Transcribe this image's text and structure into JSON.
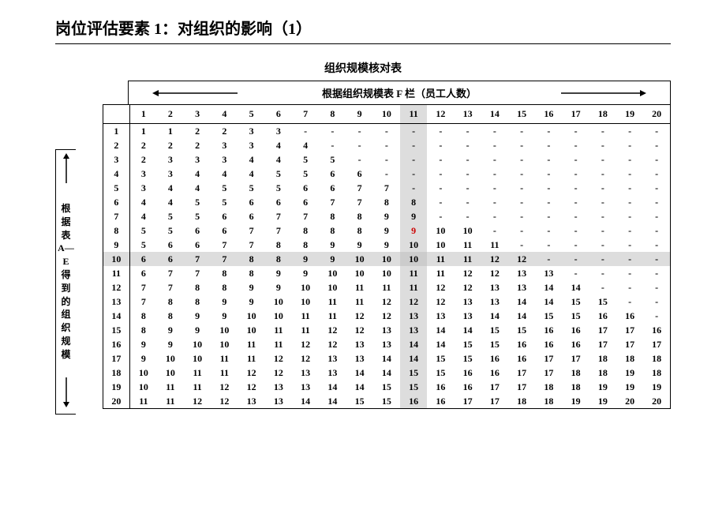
{
  "title": "岗位评估要素 1：对组织的影响（1）",
  "subtitle": "组织规模核对表",
  "topLabel": "根据组织规模表 F 栏（员工人数）",
  "sideLabel": [
    "根",
    "据",
    "表",
    "A—E",
    "得",
    "到",
    "的",
    "组",
    "织",
    "规",
    "模"
  ],
  "highlightCol": 11,
  "highlightRow": 10,
  "redCell": {
    "row": 8,
    "col": 11
  },
  "cols": [
    "1",
    "2",
    "3",
    "4",
    "5",
    "6",
    "7",
    "8",
    "9",
    "10",
    "11",
    "12",
    "13",
    "14",
    "15",
    "16",
    "17",
    "18",
    "19",
    "20"
  ],
  "rows": [
    {
      "h": "1",
      "v": [
        "1",
        "1",
        "2",
        "2",
        "3",
        "3",
        "-",
        "-",
        "-",
        "-",
        "-",
        "-",
        "-",
        "-",
        "-",
        "-",
        "-",
        "-",
        "-",
        "-"
      ]
    },
    {
      "h": "2",
      "v": [
        "2",
        "2",
        "2",
        "3",
        "3",
        "4",
        "4",
        "-",
        "-",
        "-",
        "-",
        "-",
        "-",
        "-",
        "-",
        "-",
        "-",
        "-",
        "-",
        "-"
      ]
    },
    {
      "h": "3",
      "v": [
        "2",
        "3",
        "3",
        "3",
        "4",
        "4",
        "5",
        "5",
        "-",
        "-",
        "-",
        "-",
        "-",
        "-",
        "-",
        "-",
        "-",
        "-",
        "-",
        "-"
      ]
    },
    {
      "h": "4",
      "v": [
        "3",
        "3",
        "4",
        "4",
        "4",
        "5",
        "5",
        "6",
        "6",
        "-",
        "-",
        "-",
        "-",
        "-",
        "-",
        "-",
        "-",
        "-",
        "-",
        "-"
      ]
    },
    {
      "h": "5",
      "v": [
        "3",
        "4",
        "4",
        "5",
        "5",
        "5",
        "6",
        "6",
        "7",
        "7",
        "-",
        "-",
        "-",
        "-",
        "-",
        "-",
        "-",
        "-",
        "-",
        "-"
      ]
    },
    {
      "h": "6",
      "v": [
        "4",
        "4",
        "5",
        "5",
        "6",
        "6",
        "6",
        "7",
        "7",
        "8",
        "8",
        "-",
        "-",
        "-",
        "-",
        "-",
        "-",
        "-",
        "-",
        "-"
      ]
    },
    {
      "h": "7",
      "v": [
        "4",
        "5",
        "5",
        "6",
        "6",
        "7",
        "7",
        "8",
        "8",
        "9",
        "9",
        "-",
        "-",
        "-",
        "-",
        "-",
        "-",
        "-",
        "-",
        "-"
      ]
    },
    {
      "h": "8",
      "v": [
        "5",
        "5",
        "6",
        "6",
        "7",
        "7",
        "8",
        "8",
        "8",
        "9",
        "9",
        "10",
        "10",
        "-",
        "-",
        "-",
        "-",
        "-",
        "-",
        "-"
      ]
    },
    {
      "h": "9",
      "v": [
        "5",
        "6",
        "6",
        "7",
        "7",
        "8",
        "8",
        "9",
        "9",
        "9",
        "10",
        "10",
        "11",
        "11",
        "-",
        "-",
        "-",
        "-",
        "-",
        "-"
      ]
    },
    {
      "h": "10",
      "v": [
        "6",
        "6",
        "7",
        "7",
        "8",
        "8",
        "9",
        "9",
        "10",
        "10",
        "10",
        "11",
        "11",
        "12",
        "12",
        "-",
        "-",
        "-",
        "-",
        "-"
      ]
    },
    {
      "h": "11",
      "v": [
        "6",
        "7",
        "7",
        "8",
        "8",
        "9",
        "9",
        "10",
        "10",
        "10",
        "11",
        "11",
        "12",
        "12",
        "13",
        "13",
        "-",
        "-",
        "-",
        "-"
      ]
    },
    {
      "h": "12",
      "v": [
        "7",
        "7",
        "8",
        "8",
        "9",
        "9",
        "10",
        "10",
        "11",
        "11",
        "11",
        "12",
        "12",
        "13",
        "13",
        "14",
        "14",
        "-",
        "-",
        "-"
      ]
    },
    {
      "h": "13",
      "v": [
        "7",
        "8",
        "8",
        "9",
        "9",
        "10",
        "10",
        "11",
        "11",
        "12",
        "12",
        "12",
        "13",
        "13",
        "14",
        "14",
        "15",
        "15",
        "-",
        "-"
      ]
    },
    {
      "h": "14",
      "v": [
        "8",
        "8",
        "9",
        "9",
        "10",
        "10",
        "11",
        "11",
        "12",
        "12",
        "13",
        "13",
        "13",
        "14",
        "14",
        "15",
        "15",
        "16",
        "16",
        "-"
      ]
    },
    {
      "h": "15",
      "v": [
        "8",
        "9",
        "9",
        "10",
        "10",
        "11",
        "11",
        "12",
        "12",
        "13",
        "13",
        "14",
        "14",
        "15",
        "15",
        "16",
        "16",
        "17",
        "17",
        "16"
      ]
    },
    {
      "h": "16",
      "v": [
        "9",
        "9",
        "10",
        "10",
        "11",
        "11",
        "12",
        "12",
        "13",
        "13",
        "14",
        "14",
        "15",
        "15",
        "16",
        "16",
        "16",
        "17",
        "17",
        "17"
      ]
    },
    {
      "h": "17",
      "v": [
        "9",
        "10",
        "10",
        "11",
        "11",
        "12",
        "12",
        "13",
        "13",
        "14",
        "14",
        "15",
        "15",
        "16",
        "16",
        "17",
        "17",
        "18",
        "18",
        "18"
      ]
    },
    {
      "h": "18",
      "v": [
        "10",
        "10",
        "11",
        "11",
        "12",
        "12",
        "13",
        "13",
        "14",
        "14",
        "15",
        "15",
        "16",
        "16",
        "17",
        "17",
        "18",
        "18",
        "19",
        "18"
      ]
    },
    {
      "h": "19",
      "v": [
        "10",
        "11",
        "11",
        "12",
        "12",
        "13",
        "13",
        "14",
        "14",
        "15",
        "15",
        "16",
        "16",
        "17",
        "17",
        "18",
        "18",
        "19",
        "19",
        "19"
      ]
    },
    {
      "h": "20",
      "v": [
        "11",
        "11",
        "12",
        "12",
        "13",
        "13",
        "14",
        "14",
        "15",
        "15",
        "16",
        "16",
        "17",
        "17",
        "18",
        "18",
        "19",
        "19",
        "20",
        "20"
      ]
    }
  ]
}
